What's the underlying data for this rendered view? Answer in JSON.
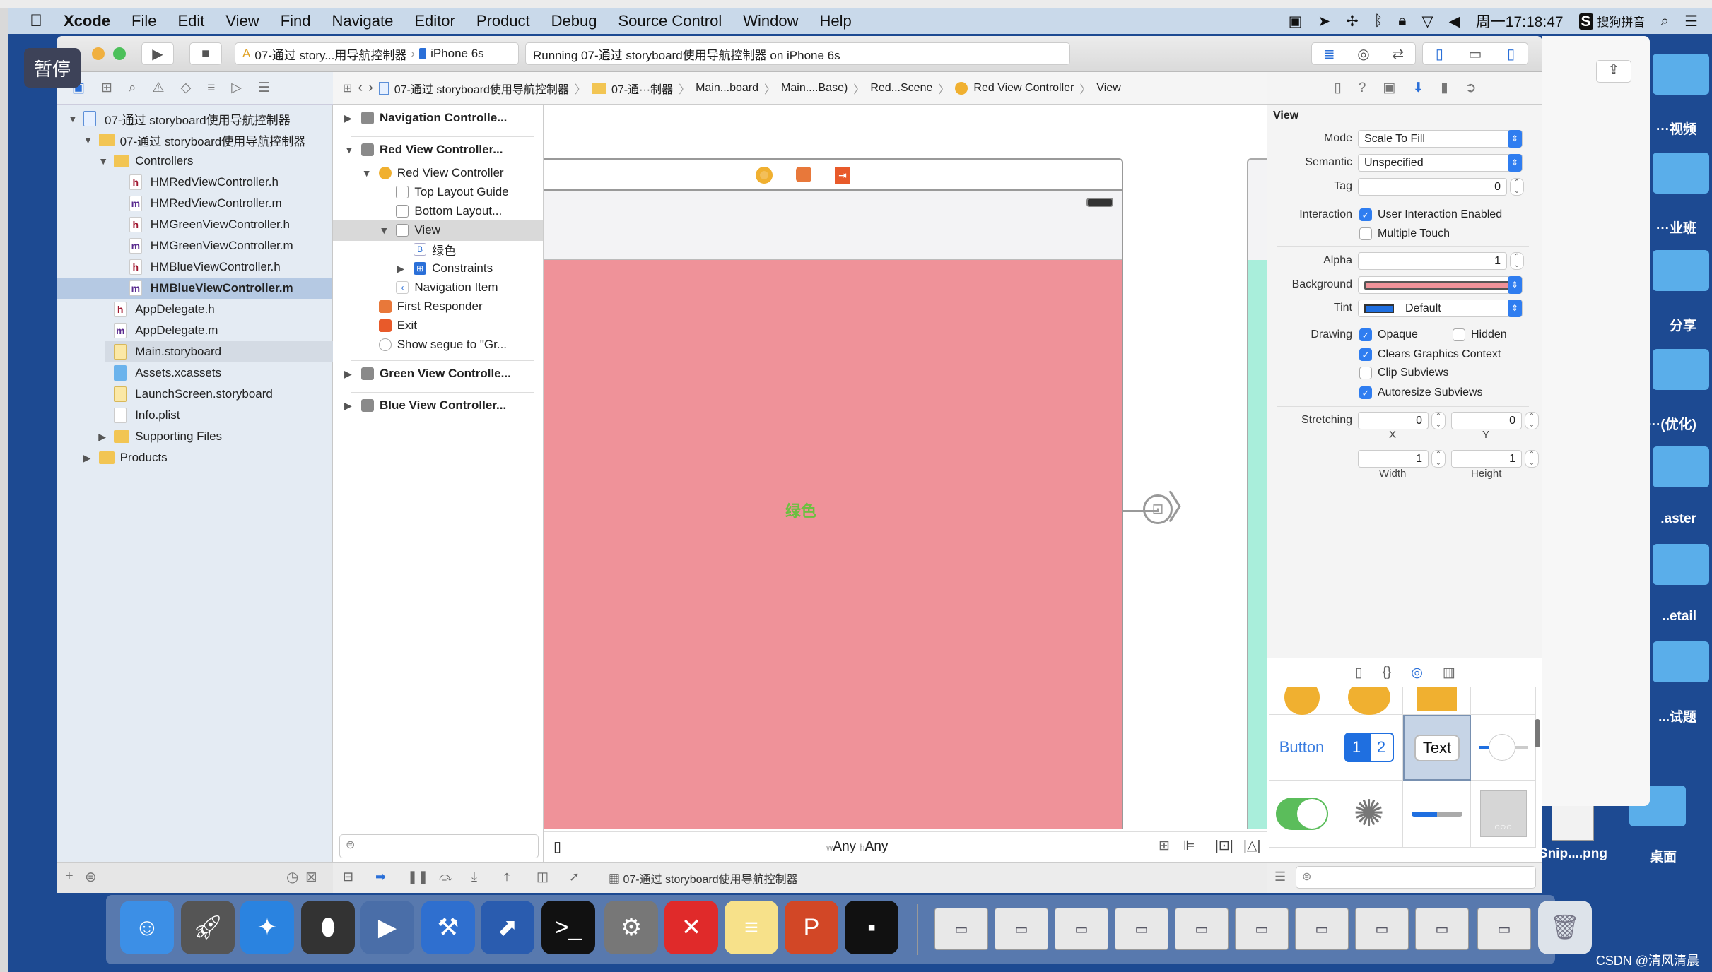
{
  "overlay": {
    "pause_label": "暂停"
  },
  "menubar": {
    "items": [
      "Xcode",
      "File",
      "Edit",
      "View",
      "Find",
      "Navigate",
      "Editor",
      "Product",
      "Debug",
      "Source Control",
      "Window",
      "Help"
    ],
    "clock": "周一17:18:47",
    "input_method": "搜狗拼音"
  },
  "toolbar": {
    "scheme": "07-通过 story...用导航控制器",
    "device": "iPhone 6s",
    "status": "Running 07-通过 storyboard使用导航控制器 on iPhone 6s"
  },
  "jumpbar": [
    "07-通过 storyboard使用导航控制器",
    "07-通···制器",
    "Main...board",
    "Main....Base)",
    "Red...Scene",
    "Red View Controller",
    "View"
  ],
  "navigator": {
    "rows": [
      {
        "label": "07-通过 storyboard使用导航控制器",
        "indent": 0,
        "icon": "project",
        "expand": "open"
      },
      {
        "label": "07-通过 storyboard使用导航控制器",
        "indent": 1,
        "icon": "folder",
        "expand": "open"
      },
      {
        "label": "Controllers",
        "indent": 2,
        "icon": "folder",
        "expand": "open"
      },
      {
        "label": "HMRedViewController.h",
        "indent": 3,
        "icon": "h"
      },
      {
        "label": "HMRedViewController.m",
        "indent": 3,
        "icon": "m"
      },
      {
        "label": "HMGreenViewController.h",
        "indent": 3,
        "icon": "h"
      },
      {
        "label": "HMGreenViewController.m",
        "indent": 3,
        "icon": "m"
      },
      {
        "label": "HMBlueViewController.h",
        "indent": 3,
        "icon": "h"
      },
      {
        "label": "HMBlueViewController.m",
        "indent": 3,
        "icon": "m",
        "selected": true
      },
      {
        "label": "AppDelegate.h",
        "indent": 2,
        "icon": "h"
      },
      {
        "label": "AppDelegate.m",
        "indent": 2,
        "icon": "m"
      },
      {
        "label": "Main.storyboard",
        "indent": 2,
        "icon": "storyboard",
        "highlight": true
      },
      {
        "label": "Assets.xcassets",
        "indent": 2,
        "icon": "assets"
      },
      {
        "label": "LaunchScreen.storyboard",
        "indent": 2,
        "icon": "storyboard"
      },
      {
        "label": "Info.plist",
        "indent": 2,
        "icon": "plist"
      },
      {
        "label": "Supporting Files",
        "indent": 2,
        "icon": "folder",
        "expand": "closed"
      },
      {
        "label": "Products",
        "indent": 1,
        "icon": "folder",
        "expand": "closed"
      }
    ]
  },
  "outline": {
    "rows": [
      {
        "label": "Navigation Controlle...",
        "indent": 0,
        "bold": true,
        "expand": "closed",
        "icon": "scene"
      },
      {
        "label": "Red View Controller...",
        "indent": 0,
        "bold": true,
        "expand": "open",
        "icon": "scene"
      },
      {
        "label": "Red View Controller",
        "indent": 1,
        "expand": "open",
        "icon": "vc"
      },
      {
        "label": "Top Layout Guide",
        "indent": 2,
        "icon": "guide"
      },
      {
        "label": "Bottom Layout...",
        "indent": 2,
        "icon": "guide"
      },
      {
        "label": "View",
        "indent": 2,
        "expand": "open",
        "icon": "view",
        "selected": true
      },
      {
        "label": "绿色",
        "indent": 3,
        "icon": "button"
      },
      {
        "label": "Constraints",
        "indent": 3,
        "expand": "closed",
        "icon": "constraints"
      },
      {
        "label": "Navigation Item",
        "indent": 2,
        "icon": "navitem"
      },
      {
        "label": "First Responder",
        "indent": 1,
        "icon": "responder"
      },
      {
        "label": "Exit",
        "indent": 1,
        "icon": "exit"
      },
      {
        "label": "Show segue to \"Gr...",
        "indent": 1,
        "icon": "segue"
      },
      {
        "label": "Green View Controlle...",
        "indent": 0,
        "bold": true,
        "expand": "closed",
        "icon": "scene"
      },
      {
        "label": "Blue View Controller...",
        "indent": 0,
        "bold": true,
        "expand": "closed",
        "icon": "scene"
      }
    ]
  },
  "canvas": {
    "button_label": "绿色",
    "size_class_w": "Any",
    "size_class_h": "Any",
    "size_class_w_prefix": "w",
    "size_class_h_prefix": "h",
    "red_color": "#ef9299",
    "green_color": "#a9eedb"
  },
  "debugbar": {
    "target": "07-通过 storyboard使用导航控制器"
  },
  "inspector": {
    "section": "View",
    "mode_label": "Mode",
    "mode": "Scale To Fill",
    "semantic_label": "Semantic",
    "semantic": "Unspecified",
    "tag_label": "Tag",
    "tag": "0",
    "interaction_label": "Interaction",
    "user_interaction": {
      "label": "User Interaction Enabled",
      "checked": true
    },
    "multiple_touch": {
      "label": "Multiple Touch",
      "checked": false
    },
    "alpha_label": "Alpha",
    "alpha": "1",
    "background_label": "Background",
    "background_color": "#ef9299",
    "tint_label": "Tint",
    "tint": "Default",
    "tint_color": "#1f6fe0",
    "drawing_label": "Drawing",
    "opaque": {
      "label": "Opaque",
      "checked": true
    },
    "hidden": {
      "label": "Hidden",
      "checked": false
    },
    "clears": {
      "label": "Clears Graphics Context",
      "checked": true
    },
    "clip": {
      "label": "Clip Subviews",
      "checked": false
    },
    "autoresize": {
      "label": "Autoresize Subviews",
      "checked": true
    },
    "stretching_label": "Stretching",
    "stretch_x": "0",
    "stretch_y": "0",
    "stretch_w": "1",
    "stretch_h": "1",
    "x_label": "X",
    "y_label": "Y",
    "width_label": "Width",
    "height_label": "Height"
  },
  "library": {
    "button_label": "Button",
    "segment_1": "1",
    "segment_2": "2",
    "textfield_label": "Text"
  },
  "desktop": {
    "items": [
      "···视频",
      "···业班",
      "分享",
      "···(优化)",
      ".aster",
      "..etail",
      "...试题",
      "桌面"
    ],
    "snip": "Snip....png"
  },
  "watermark": "CSDN @清风清晨"
}
